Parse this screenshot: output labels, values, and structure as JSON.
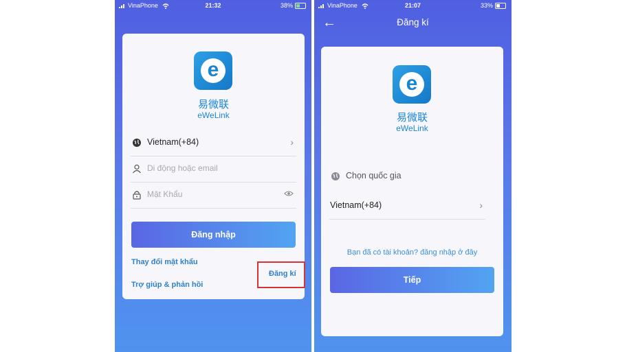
{
  "left_screen": {
    "status": {
      "carrier": "VinaPhone",
      "time": "21:32",
      "battery": "38%"
    },
    "brand_cn": "易微联",
    "brand_en": "eWeLink",
    "logo_letter": "e",
    "country": {
      "value": "Vietnam(+84)",
      "icon": "globe-icon"
    },
    "phone_email": {
      "placeholder": "Di động hoặc email",
      "icon": "user-icon"
    },
    "password": {
      "placeholder": "Mật Khẩu",
      "icon": "lock-icon"
    },
    "login_label": "Đăng nhập",
    "change_password_label": "Thay đổi mật khẩu",
    "help_label": "Trợ giúp & phản hồi",
    "register_label": "Đăng kí",
    "highlight_color": "#d63333"
  },
  "right_screen": {
    "status": {
      "carrier": "VinaPhone",
      "time": "21:07",
      "battery": "33%"
    },
    "title": "Đăng kí",
    "brand_cn": "易微联",
    "brand_en": "eWeLink",
    "logo_letter": "e",
    "choose_country_label": "Chọn quốc gia",
    "country_value": "Vietnam(+84)",
    "have_account_label": "Bạn đã có tài khoản? đăng nhập ở đây",
    "next_label": "Tiếp"
  },
  "colors": {
    "accent": "#1a86d2",
    "gradient_start": "#5a66e4",
    "gradient_end": "#52a4f2"
  }
}
